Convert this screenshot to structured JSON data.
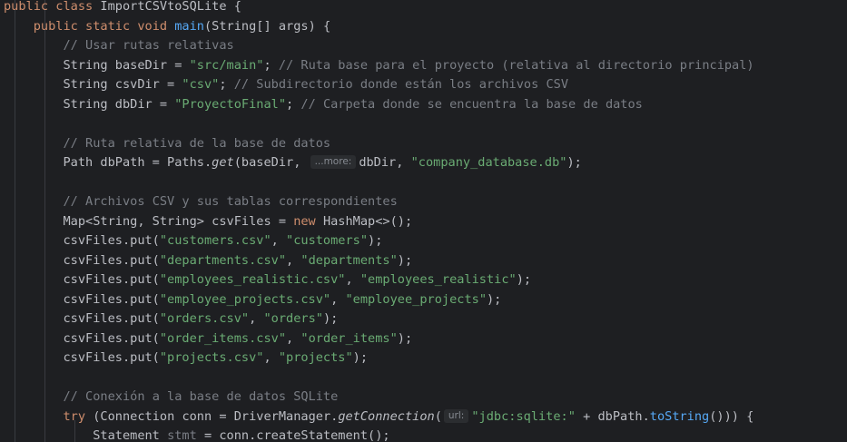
{
  "editor": {
    "lines": [
      {
        "tokens": [
          {
            "t": "public class ",
            "c": "kw"
          },
          {
            "t": "ImportCSVtoSQLite {",
            "c": ""
          }
        ]
      },
      {
        "tokens": [
          {
            "t": "    ",
            "c": ""
          },
          {
            "t": "public static void ",
            "c": "kw"
          },
          {
            "t": "main",
            "c": "fn"
          },
          {
            "t": "(String[] args) {",
            "c": ""
          }
        ]
      },
      {
        "tokens": [
          {
            "t": "        ",
            "c": ""
          },
          {
            "t": "// Usar rutas relativas",
            "c": "cm"
          }
        ]
      },
      {
        "tokens": [
          {
            "t": "        String baseDir = ",
            "c": ""
          },
          {
            "t": "\"src/main\"",
            "c": "str"
          },
          {
            "t": "; ",
            "c": ""
          },
          {
            "t": "// Ruta base para el proyecto (relativa al directorio principal)",
            "c": "cm"
          }
        ]
      },
      {
        "tokens": [
          {
            "t": "        String csvDir = ",
            "c": ""
          },
          {
            "t": "\"csv\"",
            "c": "str"
          },
          {
            "t": "; ",
            "c": ""
          },
          {
            "t": "// Subdirectorio donde están los archivos CSV",
            "c": "cm"
          }
        ]
      },
      {
        "tokens": [
          {
            "t": "        String dbDir = ",
            "c": ""
          },
          {
            "t": "\"ProyectoFinal\"",
            "c": "str"
          },
          {
            "t": "; ",
            "c": ""
          },
          {
            "t": "// Carpeta donde se encuentra la base de datos",
            "c": "cm"
          }
        ]
      },
      {
        "tokens": []
      },
      {
        "tokens": [
          {
            "t": "        ",
            "c": ""
          },
          {
            "t": "// Ruta relativa de la base de datos",
            "c": "cm"
          }
        ]
      },
      {
        "tokens": [
          {
            "t": "        Path dbPath = Paths.",
            "c": ""
          },
          {
            "t": "get",
            "c": "it"
          },
          {
            "t": "(baseDir, ",
            "c": ""
          },
          {
            "t": "...more:",
            "c": "hint"
          },
          {
            "t": "dbDir, ",
            "c": ""
          },
          {
            "t": "\"company_database.db\"",
            "c": "str"
          },
          {
            "t": ");",
            "c": ""
          }
        ]
      },
      {
        "tokens": []
      },
      {
        "tokens": [
          {
            "t": "        ",
            "c": ""
          },
          {
            "t": "// Archivos CSV y sus tablas correspondientes",
            "c": "cm"
          }
        ]
      },
      {
        "tokens": [
          {
            "t": "        Map<String, String> csvFiles = ",
            "c": ""
          },
          {
            "t": "new ",
            "c": "kw"
          },
          {
            "t": "HashMap<>();",
            "c": ""
          }
        ]
      },
      {
        "tokens": [
          {
            "t": "        csvFiles.put(",
            "c": ""
          },
          {
            "t": "\"customers.csv\"",
            "c": "str"
          },
          {
            "t": ", ",
            "c": ""
          },
          {
            "t": "\"customers\"",
            "c": "str"
          },
          {
            "t": ");",
            "c": ""
          }
        ]
      },
      {
        "tokens": [
          {
            "t": "        csvFiles.put(",
            "c": ""
          },
          {
            "t": "\"departments.csv\"",
            "c": "str"
          },
          {
            "t": ", ",
            "c": ""
          },
          {
            "t": "\"departments\"",
            "c": "str"
          },
          {
            "t": ");",
            "c": ""
          }
        ]
      },
      {
        "tokens": [
          {
            "t": "        csvFiles.put(",
            "c": ""
          },
          {
            "t": "\"employees_realistic.csv\"",
            "c": "str"
          },
          {
            "t": ", ",
            "c": ""
          },
          {
            "t": "\"employees_realistic\"",
            "c": "str"
          },
          {
            "t": ");",
            "c": ""
          }
        ]
      },
      {
        "tokens": [
          {
            "t": "        csvFiles.put(",
            "c": ""
          },
          {
            "t": "\"employee_projects.csv\"",
            "c": "str"
          },
          {
            "t": ", ",
            "c": ""
          },
          {
            "t": "\"employee_projects\"",
            "c": "str"
          },
          {
            "t": ");",
            "c": ""
          }
        ]
      },
      {
        "tokens": [
          {
            "t": "        csvFiles.put(",
            "c": ""
          },
          {
            "t": "\"orders.csv\"",
            "c": "str"
          },
          {
            "t": ", ",
            "c": ""
          },
          {
            "t": "\"orders\"",
            "c": "str"
          },
          {
            "t": ");",
            "c": ""
          }
        ]
      },
      {
        "tokens": [
          {
            "t": "        csvFiles.put(",
            "c": ""
          },
          {
            "t": "\"order_items.csv\"",
            "c": "str"
          },
          {
            "t": ", ",
            "c": ""
          },
          {
            "t": "\"order_items\"",
            "c": "str"
          },
          {
            "t": ");",
            "c": ""
          }
        ]
      },
      {
        "tokens": [
          {
            "t": "        csvFiles.put(",
            "c": ""
          },
          {
            "t": "\"projects.csv\"",
            "c": "str"
          },
          {
            "t": ", ",
            "c": ""
          },
          {
            "t": "\"projects\"",
            "c": "str"
          },
          {
            "t": ");",
            "c": ""
          }
        ]
      },
      {
        "tokens": []
      },
      {
        "tokens": [
          {
            "t": "        ",
            "c": ""
          },
          {
            "t": "// Conexión a la base de datos SQLite",
            "c": "cm"
          }
        ]
      },
      {
        "tokens": [
          {
            "t": "        ",
            "c": ""
          },
          {
            "t": "try ",
            "c": "kw"
          },
          {
            "t": "(Connection conn = DriverManager.",
            "c": ""
          },
          {
            "t": "getConnection",
            "c": "it"
          },
          {
            "t": "(",
            "c": ""
          },
          {
            "t": "url:",
            "c": "hint"
          },
          {
            "t": "\"jdbc:sqlite:\"",
            "c": "str"
          },
          {
            "t": " + dbPath.",
            "c": ""
          },
          {
            "t": "toString",
            "c": "fn"
          },
          {
            "t": "())) {",
            "c": ""
          }
        ]
      },
      {
        "tokens": [
          {
            "t": "            Statement ",
            "c": ""
          },
          {
            "t": "stmt",
            "c": "unused"
          },
          {
            "t": " = conn.createStatement();",
            "c": ""
          }
        ]
      }
    ]
  }
}
